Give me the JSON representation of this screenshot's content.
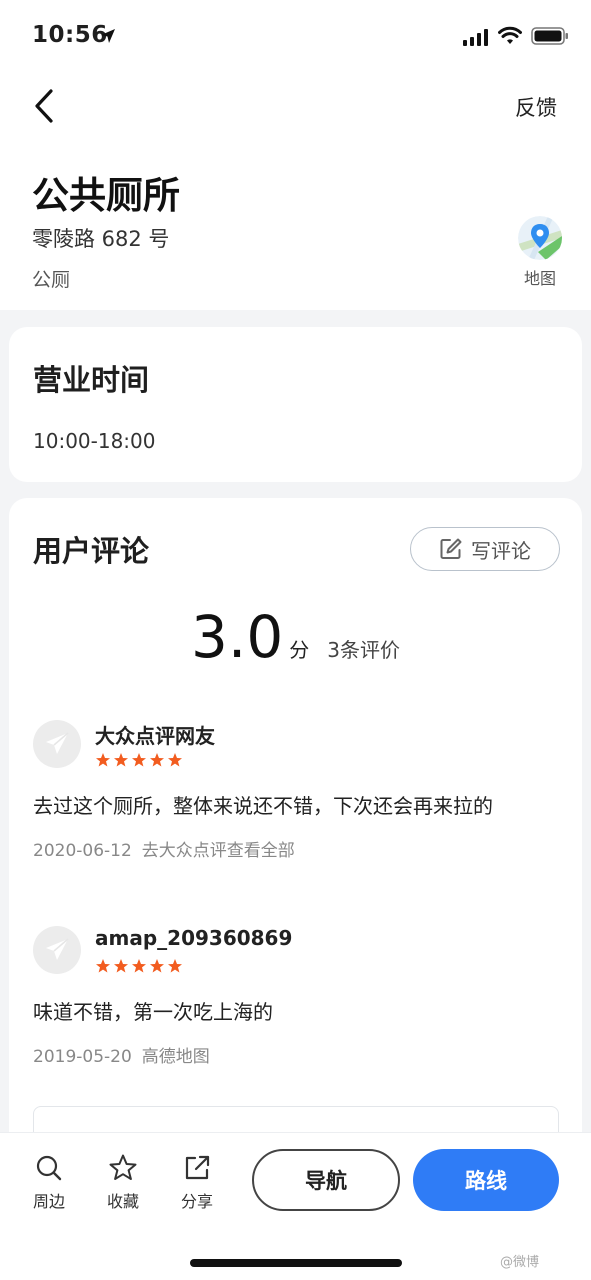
{
  "status_bar": {
    "time": "10:56"
  },
  "header": {
    "feedback_label": "反馈",
    "title": "公共厕所",
    "address": "零陵路 682 号",
    "category": "公厕",
    "map_label": "地图"
  },
  "hours": {
    "title": "营业时间",
    "value": "10:00-18:00"
  },
  "reviews": {
    "title": "用户评论",
    "write_label": "写评论",
    "score": "3.0",
    "score_unit": "分",
    "count": "3条评价",
    "items": [
      {
        "user": "大众点评网友",
        "stars": 5,
        "text": "去过这个厕所，整体来说还不错，下次还会再来拉的",
        "date": "2020-06-12",
        "source": "去大众点评查看全部"
      },
      {
        "user": "amap_209360869",
        "stars": 5,
        "text": "味道不错，第一次吃上海的",
        "date": "2019-05-20",
        "source": "高德地图"
      }
    ]
  },
  "bottom_bar": {
    "nearby_label": "周边",
    "favorite_label": "收藏",
    "share_label": "分享",
    "navigate_label": "导航",
    "route_label": "路线",
    "watermark": "@微博"
  },
  "colors": {
    "accent_blue": "#2f7cf6",
    "star_orange": "#f25c1f"
  }
}
